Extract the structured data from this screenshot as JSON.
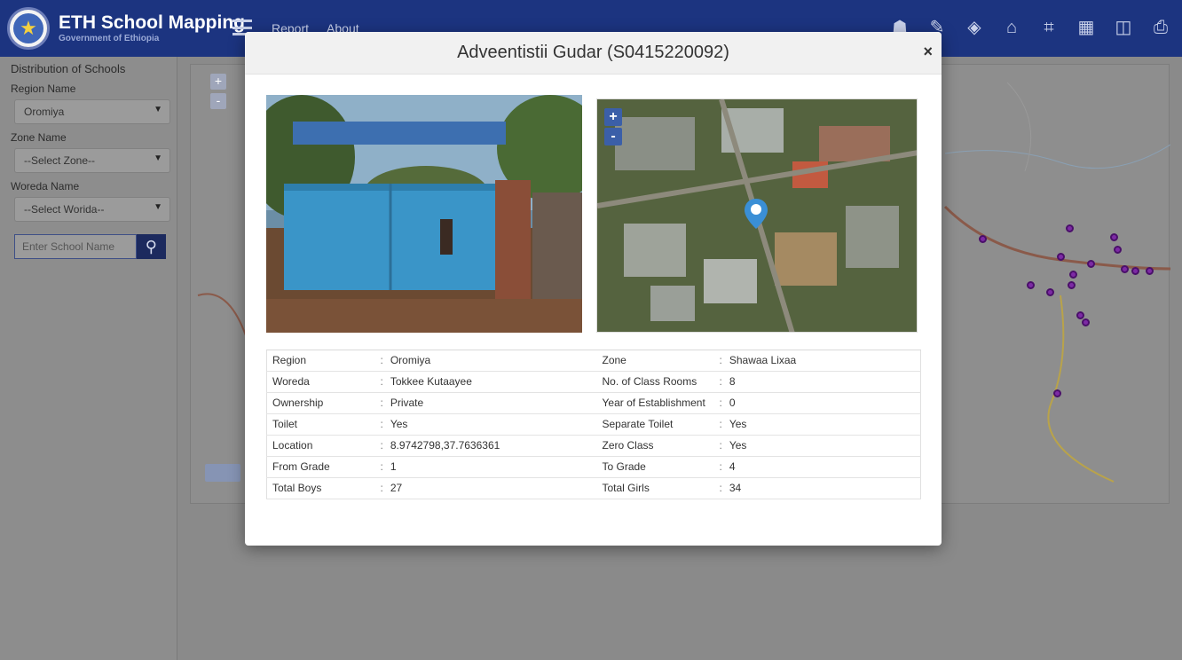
{
  "header": {
    "title": "ETH School Mapping",
    "subtitle": "Government of Ethiopia",
    "nav": [
      "Report",
      "About"
    ]
  },
  "header_icons": [
    "user-icon",
    "pencil-icon",
    "layers-icon",
    "home-icon",
    "fullscreen-icon",
    "map-icon",
    "split-icon",
    "pdf-icon"
  ],
  "sidebar": {
    "title": "Distribution of Schools",
    "region_label": "Region Name",
    "region_value": "Oromiya",
    "zone_label": "Zone Name",
    "zone_value": "--Select Zone--",
    "woreda_label": "Woreda Name",
    "woreda_value": "--Select Worida--",
    "search_placeholder": "Enter School Name"
  },
  "map": {
    "zoom_in": "+",
    "zoom_out": "-"
  },
  "modal": {
    "title": "Adveentistii Gudar (S0415220092)",
    "close": "×",
    "mini_zoom_in": "+",
    "mini_zoom_out": "-",
    "rows": [
      {
        "l1": "Region",
        "v1": "Oromiya",
        "l2": "Zone",
        "v2": "Shawaa Lixaa"
      },
      {
        "l1": "Woreda",
        "v1": "Tokkee Kutaayee",
        "l2": "No. of Class Rooms",
        "v2": "8"
      },
      {
        "l1": "Ownership",
        "v1": "Private",
        "l2": "Year of Establishment",
        "v2": "0"
      },
      {
        "l1": "Toilet",
        "v1": "Yes",
        "l2": "Separate Toilet",
        "v2": "Yes"
      },
      {
        "l1": "Location",
        "v1": "8.9742798,37.7636361",
        "l2": "Zero Class",
        "v2": "Yes"
      },
      {
        "l1": "From Grade",
        "v1": "1",
        "l2": "To Grade",
        "v2": "4"
      },
      {
        "l1": "Total Boys",
        "v1": "27",
        "l2": "Total Girls",
        "v2": "34"
      }
    ]
  },
  "colors": {
    "header_bg": "#1c3480",
    "overlay_bg": "#8a8a8a",
    "school_marker": "#7d2aa5",
    "pin": "#3a8fd6"
  }
}
